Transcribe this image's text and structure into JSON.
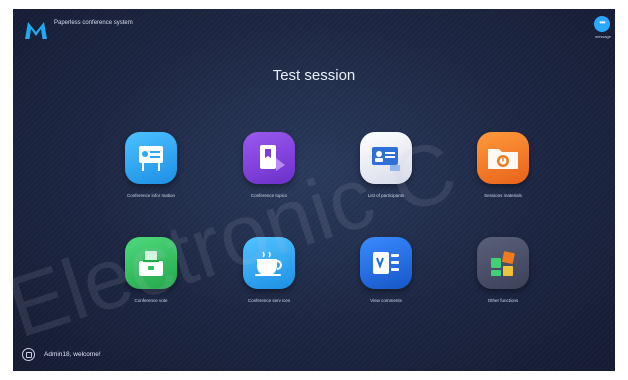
{
  "header": {
    "system_title": "Paperless conference system",
    "message_label": "message"
  },
  "session": {
    "title": "Test session"
  },
  "tiles": [
    {
      "label": "Conference infor mation",
      "icon": "info-board-icon",
      "color": "#2ba6f0"
    },
    {
      "label": "Conference topics",
      "icon": "topics-icon",
      "color": "#7b3fd6"
    },
    {
      "label": "List of participants",
      "icon": "participants-icon",
      "color": "#e6e9f4"
    },
    {
      "label": "Sessions materials",
      "icon": "folder-icon",
      "color": "#f07a1c"
    },
    {
      "label": "Conference vote",
      "icon": "ballot-box-icon",
      "color": "#2fbf5d"
    },
    {
      "label": "Conference serv ices",
      "icon": "tea-cup-icon",
      "color": "#2ba6f0"
    },
    {
      "label": "View comments",
      "icon": "comments-icon",
      "color": "#1f6fe0"
    },
    {
      "label": "Other functions",
      "icon": "apps-icon",
      "color": "#4a5068"
    }
  ],
  "footer": {
    "welcome": "Admin18, welcome!"
  },
  "watermark": "Electronic C"
}
